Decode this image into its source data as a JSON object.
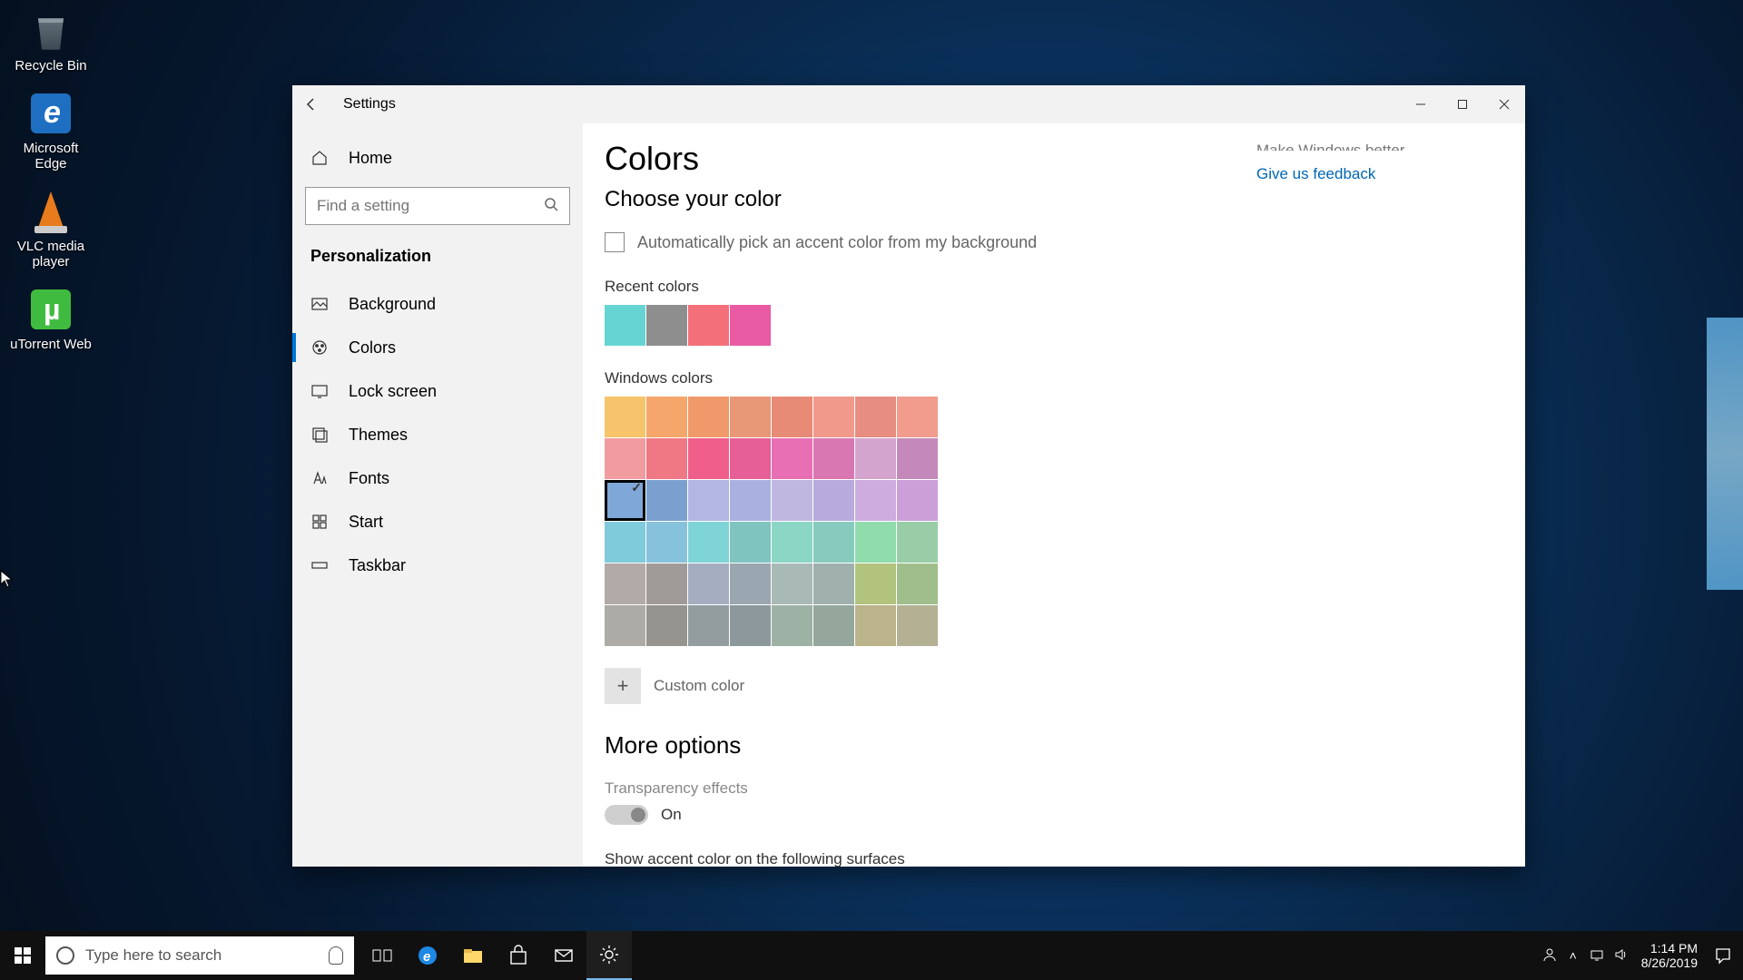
{
  "desktop": {
    "icons": [
      {
        "label": "Recycle Bin"
      },
      {
        "label": "Microsoft Edge"
      },
      {
        "label": "VLC media player"
      },
      {
        "label": "uTorrent Web"
      }
    ]
  },
  "window": {
    "title": "Settings",
    "sidebar": {
      "home": "Home",
      "search_placeholder": "Find a setting",
      "section": "Personalization",
      "items": [
        {
          "label": "Background"
        },
        {
          "label": "Colors"
        },
        {
          "label": "Lock screen"
        },
        {
          "label": "Themes"
        },
        {
          "label": "Fonts"
        },
        {
          "label": "Start"
        },
        {
          "label": "Taskbar"
        }
      ]
    },
    "page": {
      "title": "Colors",
      "subtitle": "Choose your color",
      "auto_accent_label": "Automatically pick an accent color from my background",
      "recent_label": "Recent colors",
      "recent_colors": [
        "#67d4d4",
        "#8e8e8e",
        "#f3707a",
        "#e85ba3"
      ],
      "windows_label": "Windows colors",
      "windows_colors": [
        "#f7c46c",
        "#f5a76b",
        "#f0996b",
        "#e89777",
        "#e88b76",
        "#f19a8c",
        "#e78d82",
        "#f19c8d",
        "#f19ca0",
        "#f07784",
        "#ef5f8a",
        "#e65f96",
        "#e86fb4",
        "#d977b2",
        "#d3a4ce",
        "#c489ba",
        "#7fa8d9",
        "#7aa0cf",
        "#b2b6e1",
        "#aab1e1",
        "#c0b7e0",
        "#b6abdb",
        "#ceacdf",
        "#cc9fd9",
        "#7fcbdb",
        "#86c2dc",
        "#7fd4d8",
        "#7fc4bf",
        "#8cd6c5",
        "#86cbbe",
        "#90dcad",
        "#98cda7",
        "#b2aaa8",
        "#a09a98",
        "#a5aec0",
        "#9aa6b0",
        "#a8b9b6",
        "#9fb0ad",
        "#b2c37e",
        "#a0be8b",
        "#adaba5",
        "#96948f",
        "#939da0",
        "#8c989c",
        "#9eb1a5",
        "#95a79c",
        "#bab38b",
        "#b3b094"
      ],
      "selected_index": 16,
      "custom_label": "Custom color",
      "more_options": "More options",
      "transparency_label": "Transparency effects",
      "transparency_value": "On",
      "accent_surfaces_label": "Show accent color on the following surfaces"
    },
    "aside": {
      "cut_text": "Make Windows better",
      "feedback": "Give us feedback"
    }
  },
  "taskbar": {
    "search_placeholder": "Type here to search",
    "time": "1:14 PM",
    "date": "8/26/2019"
  }
}
